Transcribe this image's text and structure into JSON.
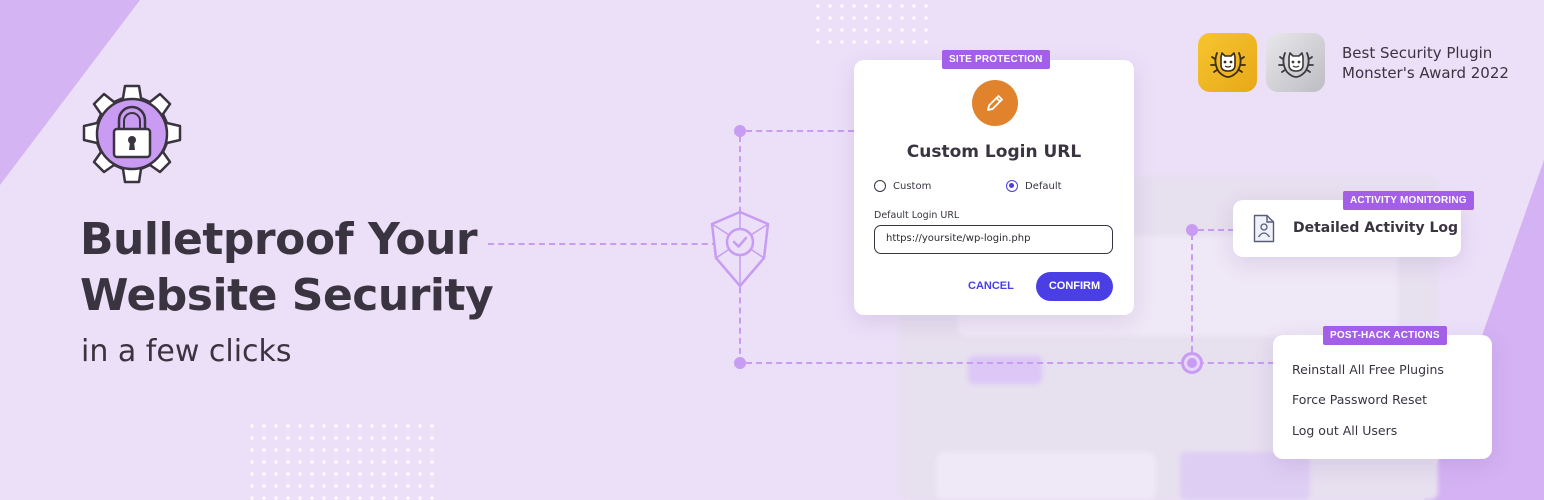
{
  "headline": {
    "line1": "Bulletproof Your",
    "line2": "Website Security",
    "sub": "in a few clicks"
  },
  "login_card": {
    "tag": "SITE PROTECTION",
    "title": "Custom Login URL",
    "radio_custom": "Custom",
    "radio_default": "Default",
    "selected": "Default",
    "field_label": "Default Login URL",
    "field_value": "https://yoursite/wp-login.php",
    "cancel": "CANCEL",
    "confirm": "CONFIRM"
  },
  "activity_card": {
    "tag": "ACTIVITY MONITORING",
    "label": "Detailed Activity Log"
  },
  "post_hack_card": {
    "tag": "POST-HACK ACTIONS",
    "items": [
      "Reinstall All Free Plugins",
      "Force Password Reset",
      "Log out All Users"
    ]
  },
  "award": {
    "line1": "Best Security Plugin",
    "line2": "Monster's Award 2022"
  },
  "icons": {
    "hero": "lock-gear-icon",
    "shield": "shield-check-icon",
    "pencil": "pencil-icon",
    "log": "activity-log-icon",
    "medal": "monster-laurel-icon"
  },
  "colors": {
    "background": "#ece0f8",
    "accent_purple": "#a35fe8",
    "primary_button": "#4a3fe4",
    "pencil_badge": "#e0832c",
    "medal_gold": "#f6c52f",
    "medal_silver": "#d6d6da"
  }
}
